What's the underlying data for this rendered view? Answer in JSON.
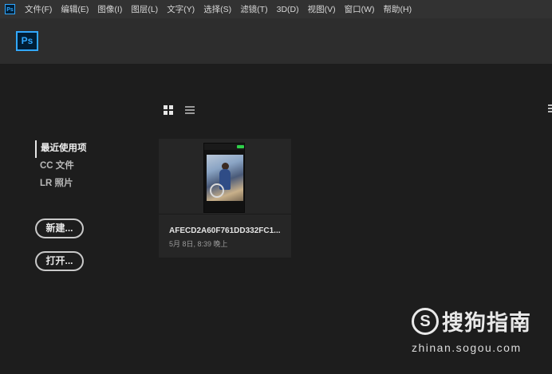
{
  "menubar": {
    "app_icon": "Ps",
    "items": [
      "文件(F)",
      "编辑(E)",
      "图像(I)",
      "图层(L)",
      "文字(Y)",
      "选择(S)",
      "滤镜(T)",
      "3D(D)",
      "视图(V)",
      "窗口(W)",
      "帮助(H)"
    ]
  },
  "header": {
    "logo": "Ps"
  },
  "view_toggles": {
    "grid_icon": "grid-view-icon",
    "list_icon": "list-view-icon"
  },
  "nav": {
    "items": [
      "最近使用项",
      "CC 文件",
      "LR 照片"
    ],
    "active": "最近使用项"
  },
  "buttons": {
    "new": "新建...",
    "open": "打开..."
  },
  "recent": {
    "files": [
      {
        "name": "AFECD2A60F761DD332FC1...",
        "date": "5月 8日, 8:39 晚上"
      }
    ]
  },
  "watermark": {
    "logo": "S",
    "brand": "搜狗指南",
    "url": "zhinan.sogou.com"
  },
  "colors": {
    "accent": "#31a8ff",
    "background": "#1d1d1d",
    "menubar": "#323232",
    "header": "#2d2d2d"
  }
}
